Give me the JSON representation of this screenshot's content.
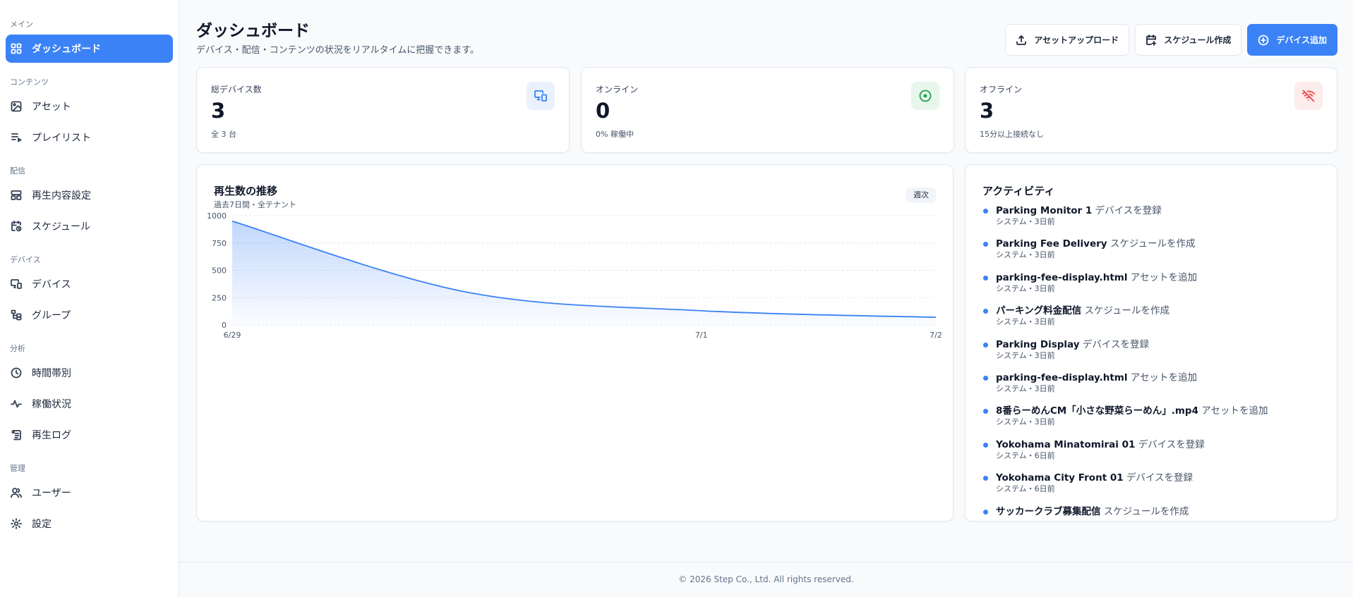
{
  "sidebar": {
    "sections": [
      {
        "label": "メイン",
        "items": [
          {
            "label": "ダッシュボード",
            "icon": "dashboard-icon",
            "active": true
          }
        ]
      },
      {
        "label": "コンテンツ",
        "items": [
          {
            "label": "アセット",
            "icon": "image-icon"
          },
          {
            "label": "プレイリスト",
            "icon": "playlist-icon"
          }
        ]
      },
      {
        "label": "配信",
        "items": [
          {
            "label": "再生内容設定",
            "icon": "layout-icon"
          },
          {
            "label": "スケジュール",
            "icon": "calendar-clock-icon"
          }
        ]
      },
      {
        "label": "デバイス",
        "items": [
          {
            "label": "デバイス",
            "icon": "devices-icon"
          },
          {
            "label": "グループ",
            "icon": "group-tree-icon"
          }
        ]
      },
      {
        "label": "分析",
        "items": [
          {
            "label": "時間帯別",
            "icon": "clock-icon"
          },
          {
            "label": "稼働状況",
            "icon": "activity-icon"
          },
          {
            "label": "再生ログ",
            "icon": "scroll-log-icon"
          }
        ]
      },
      {
        "label": "管理",
        "items": [
          {
            "label": "ユーザー",
            "icon": "users-icon"
          },
          {
            "label": "設定",
            "icon": "gear-icon"
          }
        ]
      }
    ]
  },
  "header": {
    "title": "ダッシュボード",
    "subtitle": "デバイス・配信・コンテンツの状況をリアルタイムに把握できます。",
    "buttons": {
      "upload": "アセットアップロード",
      "schedule": "スケジュール作成",
      "add_device": "デバイス追加"
    }
  },
  "stats": [
    {
      "label": "総デバイス数",
      "value": "3",
      "note": "全 3 台",
      "icon": "monitor-devices-icon",
      "icon_bg": "#eaf1fd",
      "icon_color": "#3b82f6"
    },
    {
      "label": "オンライン",
      "value": "0",
      "note": "0% 稼働中",
      "icon": "online-circle-icon",
      "icon_bg": "#e8f6ec",
      "icon_color": "#22a34a"
    },
    {
      "label": "オフライン",
      "value": "3",
      "note": "15分以上接続なし",
      "icon": "wifi-off-icon",
      "icon_bg": "#fdecec",
      "icon_color": "#ef4444"
    }
  ],
  "chart_panel": {
    "title": "再生数の推移",
    "subtitle": "過去7日間・全テナント",
    "badge": "週次"
  },
  "chart_data": {
    "type": "area",
    "title": "再生数の推移",
    "x": [
      "6/29",
      "6/30",
      "7/1",
      "7/2"
    ],
    "x_tick_labels": [
      "6/29",
      "7/1",
      "7/2"
    ],
    "values": [
      950,
      300,
      130,
      70
    ],
    "y_ticks": [
      0,
      250,
      500,
      750,
      1000
    ],
    "ylim": [
      0,
      1000
    ],
    "grid": true,
    "color": "#3b82f6"
  },
  "activity": {
    "title": "アクティビティ",
    "items": [
      {
        "subject": "Parking Monitor 1",
        "action": "デバイスを登録",
        "meta": "システム・3日前"
      },
      {
        "subject": "Parking Fee Delivery",
        "action": "スケジュールを作成",
        "meta": "システム・3日前"
      },
      {
        "subject": "parking-fee-display.html",
        "action": "アセットを追加",
        "meta": "システム・3日前"
      },
      {
        "subject": "パーキング料金配信",
        "action": "スケジュールを作成",
        "meta": "システム・3日前"
      },
      {
        "subject": "Parking Display",
        "action": "デバイスを登録",
        "meta": "システム・3日前"
      },
      {
        "subject": "parking-fee-display.html",
        "action": "アセットを追加",
        "meta": "システム・3日前"
      },
      {
        "subject": "8番らーめんCM「小さな野菜らーめん」.mp4",
        "action": "アセットを追加",
        "meta": "システム・3日前"
      },
      {
        "subject": "Yokohama Minatomirai 01",
        "action": "デバイスを登録",
        "meta": "システム・6日前"
      },
      {
        "subject": "Yokohama City Front 01",
        "action": "デバイスを登録",
        "meta": "システム・6日前"
      },
      {
        "subject": "サッカークラブ募集配信",
        "action": "スケジュールを作成",
        "meta": ""
      }
    ]
  },
  "footer": {
    "text": "© 2026 Step Co., Ltd. All rights reserved."
  },
  "colors": {
    "accent": "#3b82f6",
    "background": "#f8fafc"
  }
}
